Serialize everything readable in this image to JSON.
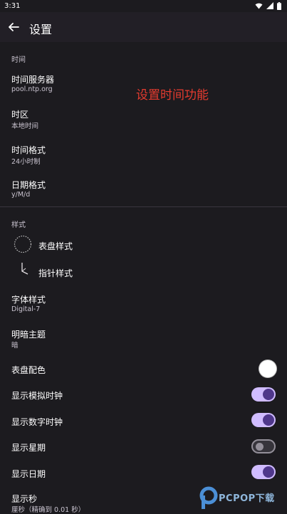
{
  "status_bar": {
    "time": "3:31"
  },
  "app_bar": {
    "title": "设置"
  },
  "overlay_caption": "设置时间功能",
  "time_section": {
    "header": "时间",
    "items": [
      {
        "title": "时间服务器",
        "value": "pool.ntp.org"
      },
      {
        "title": "时区",
        "value": "本地时间"
      },
      {
        "title": "时间格式",
        "value": "24小时制"
      },
      {
        "title": "日期格式",
        "value": "y/M/d"
      }
    ]
  },
  "style_section": {
    "header": "样式",
    "dial_style": "表盘样式",
    "hand_style": "指针样式",
    "font_style": {
      "title": "字体样式",
      "value": "Digital-7"
    },
    "theme": {
      "title": "明暗主题",
      "value": "暗"
    },
    "dial_color": {
      "title": "表盘配色",
      "color": "#ffffff"
    },
    "toggles": [
      {
        "label": "显示模拟时钟",
        "on": true
      },
      {
        "label": "显示数字时钟",
        "on": true
      },
      {
        "label": "显示星期",
        "on": false
      },
      {
        "label": "显示日期",
        "on": true
      }
    ],
    "show_seconds": {
      "title": "显示秒",
      "value": "厘秒（精确到 0.01 秒）"
    }
  },
  "watermark": {
    "text": "PCPOP下载"
  },
  "colors": {
    "background": "#1c1b1f",
    "app_bar": "#221f26",
    "accent": "#d0bcff",
    "switch_thumb_on": "#4f378b",
    "overlay_text": "#e53b2f"
  },
  "icons": [
    "back-arrow-icon",
    "wifi-icon",
    "cellular-signal-icon",
    "battery-icon",
    "dial-style-icon",
    "clock-hand-icon",
    "pcpop-logo-icon"
  ]
}
